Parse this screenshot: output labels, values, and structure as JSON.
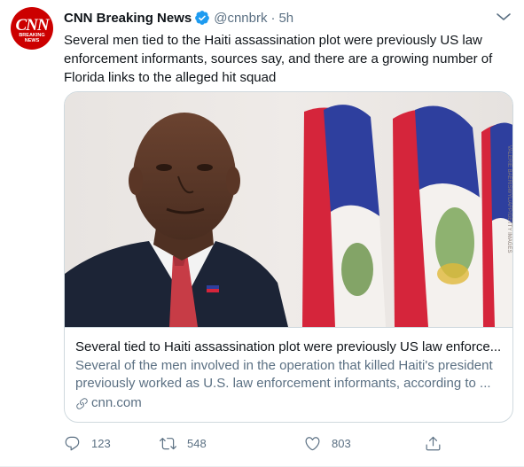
{
  "account": {
    "avatar_logo": "CNN",
    "avatar_sub_line1": "BREAKING",
    "avatar_sub_line2": "NEWS",
    "name": "CNN Breaking News",
    "handle": "@cnnbrk",
    "separator": "·",
    "time": "5h"
  },
  "tweet": {
    "text": "Several men tied to the Haiti assassination plot were previously US law enforcement informants, sources say, and there are a growing number of Florida links to the alleged hit squad"
  },
  "card": {
    "title": "Several tied to Haiti assassination plot were previously US law enforce...",
    "description": "Several of the men involved in the operation that killed Haiti's president previously worked as U.S. law enforcement informants, according to ...",
    "domain": "cnn.com"
  },
  "actions": {
    "replies": "123",
    "retweets": "548",
    "likes": "803"
  },
  "colors": {
    "brand_red": "#cc0000",
    "verified_blue": "#1d9bf0",
    "muted_text": "#5b7083",
    "border": "#cfd9de"
  },
  "icons": [
    "verified-icon",
    "more-icon",
    "link-icon",
    "reply-icon",
    "retweet-icon",
    "like-icon",
    "share-icon"
  ]
}
